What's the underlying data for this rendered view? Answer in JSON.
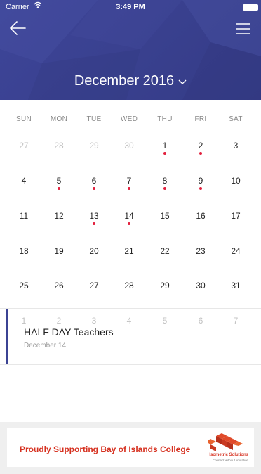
{
  "status_bar": {
    "carrier": "Carrier",
    "time": "3:49 PM"
  },
  "header": {
    "month_label": "December 2016",
    "icons": {
      "back": "arrow-left-icon",
      "menu": "hamburger-menu-icon",
      "month_picker": "chevron-down-icon"
    }
  },
  "calendar": {
    "weekdays": [
      "SUN",
      "MON",
      "TUE",
      "WED",
      "THU",
      "FRI",
      "SAT"
    ],
    "weeks": [
      [
        {
          "d": "27",
          "m": true
        },
        {
          "d": "28",
          "m": true
        },
        {
          "d": "29",
          "m": true
        },
        {
          "d": "30",
          "m": true
        },
        {
          "d": "1",
          "e": true
        },
        {
          "d": "2",
          "e": true
        },
        {
          "d": "3"
        }
      ],
      [
        {
          "d": "4"
        },
        {
          "d": "5",
          "e": true
        },
        {
          "d": "6",
          "e": true
        },
        {
          "d": "7",
          "e": true
        },
        {
          "d": "8",
          "e": true
        },
        {
          "d": "9",
          "e": true
        },
        {
          "d": "10"
        }
      ],
      [
        {
          "d": "11"
        },
        {
          "d": "12"
        },
        {
          "d": "13",
          "e": true
        },
        {
          "d": "14",
          "e": true,
          "s": true
        },
        {
          "d": "15"
        },
        {
          "d": "16"
        },
        {
          "d": "17"
        }
      ],
      [
        {
          "d": "18"
        },
        {
          "d": "19"
        },
        {
          "d": "20"
        },
        {
          "d": "21"
        },
        {
          "d": "22"
        },
        {
          "d": "23"
        },
        {
          "d": "24"
        }
      ],
      [
        {
          "d": "25"
        },
        {
          "d": "26"
        },
        {
          "d": "27"
        },
        {
          "d": "28"
        },
        {
          "d": "29"
        },
        {
          "d": "30"
        },
        {
          "d": "31"
        }
      ],
      [
        {
          "d": "1",
          "m": true
        },
        {
          "d": "2",
          "m": true
        },
        {
          "d": "3",
          "m": true
        },
        {
          "d": "4",
          "m": true
        },
        {
          "d": "5",
          "m": true
        },
        {
          "d": "6",
          "m": true
        },
        {
          "d": "7",
          "m": true
        }
      ]
    ]
  },
  "event": {
    "title": "HALF DAY Teachers",
    "date": "December 14"
  },
  "banner": {
    "text": "Proudly Supporting Bay of Islands College",
    "brand": "Isometric Solutions",
    "tagline": "Connect without limitation"
  },
  "colors": {
    "header": "#3b4393",
    "event_dot": "#e2203d",
    "banner_text": "#d6301f",
    "accent_bar": "#3b4393"
  }
}
